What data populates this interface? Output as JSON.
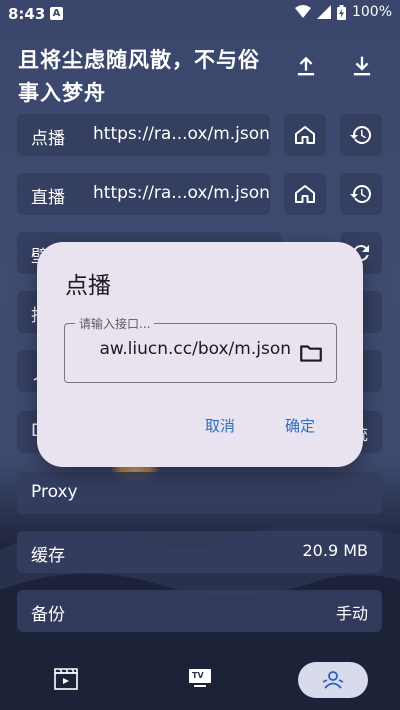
{
  "status_bar": {
    "time": "8:43",
    "notification_icon": "A",
    "battery": "100%"
  },
  "header": {
    "title": "且将尘虑随风散，不与俗事入梦舟"
  },
  "settings": {
    "vod": {
      "label": "点播",
      "url": "https://ra...ox/m.json"
    },
    "live": {
      "label": "直播",
      "url": "https://ra...ox/m.json"
    },
    "partial_rows": {
      "wallpaper_label_fragment": "壁",
      "row4_fragment": "抻",
      "row5_fragment": "ノ",
      "row6_fragment": "D",
      "row6_value_fragment": "统"
    },
    "proxy": {
      "label": "Proxy"
    },
    "cache": {
      "label": "缓存",
      "value": "20.9 MB"
    },
    "backup": {
      "label": "备份",
      "value": "手动"
    }
  },
  "dialog": {
    "title": "点播",
    "input_label": "请输入接口...",
    "input_value": "aw.liucn.cc/box/m.json",
    "cancel_label": "取消",
    "ok_label": "确定"
  },
  "bottom_nav": {
    "tv_badge": "TV"
  }
}
